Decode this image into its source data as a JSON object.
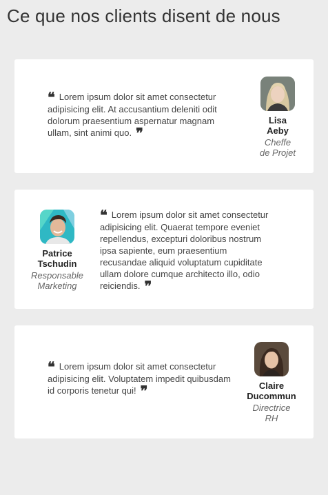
{
  "page": {
    "title": "Ce que nos clients disent de nous"
  },
  "testimonials": [
    {
      "quote": "Lorem ipsum dolor sit amet consectetur adipisicing elit. At accusantium deleniti odit dolorum praesentium aspernatur magnam ullam, sint animi quo.",
      "name_line1": "Lisa",
      "name_line2": "Aeby",
      "role_line1": "Cheffe",
      "role_line2": "de Projet"
    },
    {
      "quote": "Lorem ipsum dolor sit amet consectetur adipisicing elit. Quaerat tempore eveniet repellendus, excepturi doloribus nostrum ipsa sapiente, eum praesentium recusandae aliquid voluptatum cupiditate ullam dolore cumque architecto illo, odio reiciendis.",
      "name_line1": "Patrice",
      "name_line2": "Tschudin",
      "role_line1": "Responsable",
      "role_line2": "Marketing"
    },
    {
      "quote": "Lorem ipsum dolor sit amet consectetur adipisicing elit. Voluptatem impedit quibusdam id corporis tenetur qui!",
      "name_line1": "Claire",
      "name_line2": "Ducommun",
      "role_line1": "Directrice",
      "role_line2": "RH"
    }
  ],
  "icons": {
    "open_quote": "❝",
    "close_quote": "❞"
  },
  "colors": {
    "background": "#ececec",
    "card": "#ffffff",
    "text": "#333333"
  }
}
